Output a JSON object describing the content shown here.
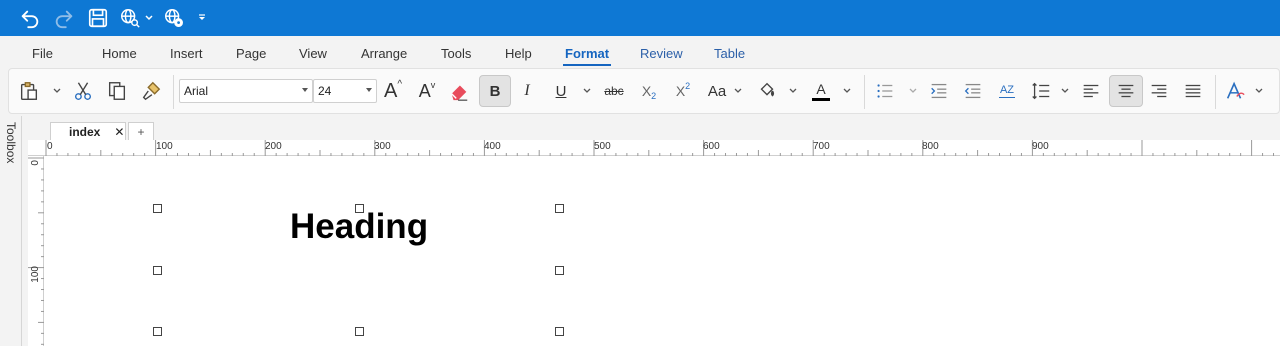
{
  "titlebar": {
    "accent_color": "#0e78d4",
    "icons": [
      "undo-icon",
      "redo-icon",
      "save-icon",
      "web-preview-icon",
      "globe-settings-icon",
      "customize-caret-icon"
    ]
  },
  "menu": {
    "tabs": [
      "File",
      "Home",
      "Insert",
      "Page",
      "View",
      "Arrange",
      "Tools",
      "Help",
      "Format",
      "Review",
      "Table"
    ],
    "active": "Format"
  },
  "ribbon": {
    "font_name": "Arial",
    "font_size": "24",
    "bold_label": "B",
    "italic_label": "I",
    "underline_label": "U",
    "strike_label": "abc",
    "subscript_label": "X",
    "subscript_sub": "2",
    "superscript_label": "X",
    "superscript_sup": "2",
    "change_case_label": "Aa",
    "grow_font_label": "A",
    "shrink_font_label": "A",
    "font_color_label": "A",
    "sort_label": "AZ"
  },
  "toolbox": {
    "label": "Toolbox"
  },
  "doc_tabs": {
    "active_tab": "index",
    "close_glyph": "✕",
    "add_glyph": "+"
  },
  "ruler": {
    "h_labels": [
      "0",
      "100",
      "200",
      "300",
      "400",
      "500",
      "600",
      "700",
      "800",
      "900"
    ],
    "v_labels": [
      "0",
      "100"
    ]
  },
  "canvas": {
    "heading_text": "Heading"
  }
}
